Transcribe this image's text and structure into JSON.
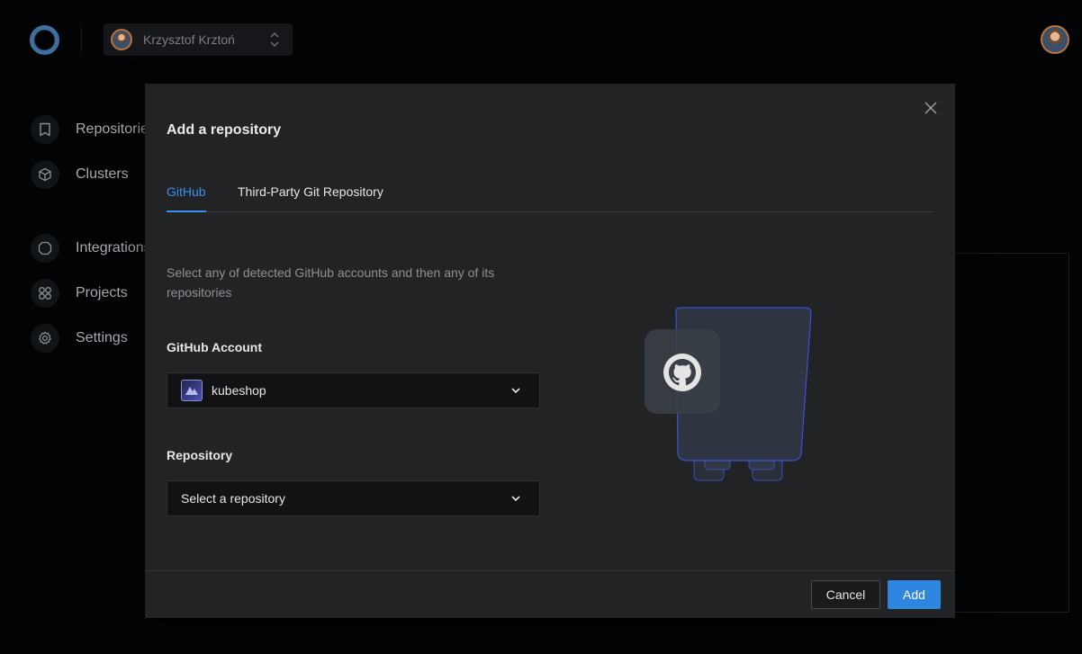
{
  "user": {
    "name": "Krzysztof Krztoń"
  },
  "sidebar": {
    "items": [
      {
        "label": "Repositories",
        "icon": "bookmark-icon"
      },
      {
        "label": "Clusters",
        "icon": "cube-icon"
      },
      {
        "label": "Integrations",
        "icon": "octagon-icon"
      },
      {
        "label": "Projects",
        "icon": "grid-icon"
      },
      {
        "label": "Settings",
        "icon": "gear-icon"
      }
    ]
  },
  "modal": {
    "title": "Add a repository",
    "tabs": [
      {
        "label": "GitHub",
        "active": true
      },
      {
        "label": "Third-Party Git Repository",
        "active": false
      }
    ],
    "description": "Select any of detected GitHub accounts and then any of its repositories",
    "account": {
      "label": "GitHub Account",
      "value": "kubeshop"
    },
    "repository": {
      "label": "Repository",
      "placeholder": "Select a repository"
    },
    "cancel_label": "Cancel",
    "add_label": "Add"
  },
  "colors": {
    "accent": "#2f86e0",
    "tab_active": "#3c8fe8",
    "modal_bg": "#222324",
    "page_bg": "#020304"
  }
}
